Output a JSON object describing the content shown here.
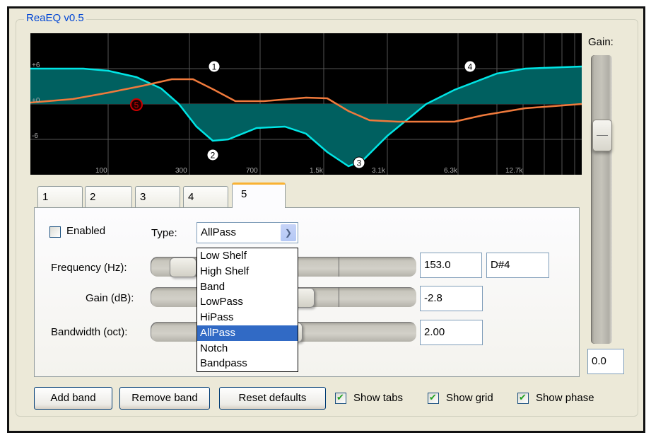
{
  "window": {
    "group_title": "ReaEQ v0.5"
  },
  "colors": {
    "graph_bg": "#000000",
    "grid": "#555555",
    "eq_curve": "#00e5e5",
    "eq_fill": "#006060",
    "phase_curve": "#f07a3c",
    "band_marker": "#ffffff",
    "selected_band_marker": "#cc0000",
    "accent_title": "#0046d5",
    "selection": "#316ac5"
  },
  "graph": {
    "y_labels": [
      "+6",
      "+0",
      "-6"
    ],
    "x_labels": [
      "100",
      "300",
      "700",
      "1.5k",
      "3.1k",
      "6.3k",
      "12.7k"
    ],
    "band_markers": [
      {
        "label": "1",
        "selected": false
      },
      {
        "label": "2",
        "selected": false
      },
      {
        "label": "3",
        "selected": false
      },
      {
        "label": "4",
        "selected": false
      },
      {
        "label": "5",
        "selected": true
      }
    ]
  },
  "gain": {
    "label": "Gain:",
    "value": "0.0",
    "slider_fraction": 0.25
  },
  "tabs": [
    {
      "label": "1",
      "active": false
    },
    {
      "label": "2",
      "active": false
    },
    {
      "label": "3",
      "active": false
    },
    {
      "label": "4",
      "active": false
    },
    {
      "label": "5",
      "active": true
    }
  ],
  "band": {
    "enabled_label": "Enabled",
    "enabled": false,
    "type_label": "Type:",
    "type_value": "AllPass",
    "type_options": [
      "Low Shelf",
      "High Shelf",
      "Band",
      "LowPass",
      "HiPass",
      "AllPass",
      "Notch",
      "Bandpass"
    ],
    "frequency": {
      "label": "Frequency (Hz):",
      "value": "153.0",
      "note": "D#4"
    },
    "gain": {
      "label": "Gain (dB):",
      "value": "-2.8"
    },
    "bandwidth": {
      "label": "Bandwidth (oct):",
      "value": "2.00"
    }
  },
  "buttons": {
    "add_band": "Add band",
    "remove_band": "Remove band",
    "reset_defaults": "Reset defaults"
  },
  "options": [
    {
      "label": "Show tabs",
      "checked": true
    },
    {
      "label": "Show grid",
      "checked": true
    },
    {
      "label": "Show phase",
      "checked": true
    }
  ]
}
